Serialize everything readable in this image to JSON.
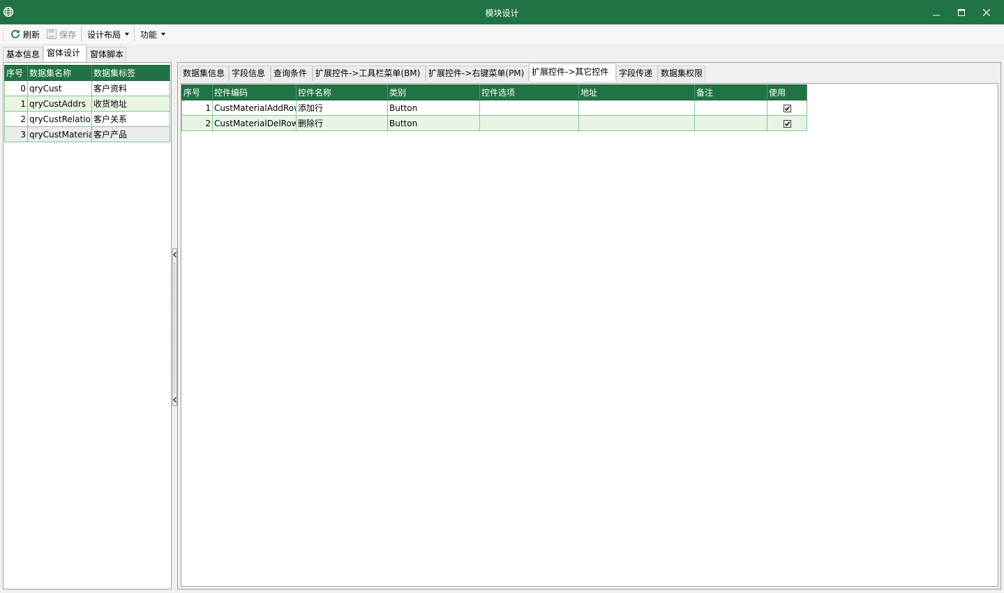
{
  "window": {
    "title": "模块设计",
    "controls": [
      "minimize",
      "maximize",
      "close"
    ]
  },
  "toolbar": {
    "refresh_label": "刷新",
    "save_label": "保存",
    "layout_label": "设计布局",
    "function_label": "功能"
  },
  "top_tabs": [
    "基本信息",
    "窗体设计",
    "窗体脚本"
  ],
  "left_grid": {
    "columns": [
      "序号",
      "数据集名称",
      "数据集标签"
    ],
    "rows": [
      {
        "index": "0",
        "name": "qryCust",
        "label": "客户资料"
      },
      {
        "index": "1",
        "name": "qryCustAddrs",
        "label": "收货地址"
      },
      {
        "index": "2",
        "name": "qryCustRelation",
        "label": "客户关系"
      },
      {
        "index": "3",
        "name": "qryCustMaterial",
        "label": "客户产品"
      }
    ]
  },
  "right_tabs": [
    "数据集信息",
    "字段信息",
    "查询条件",
    "扩展控件->工具栏菜单(BM)",
    "扩展控件->右键菜单(PM)",
    "扩展控件->其它控件",
    "字段传递",
    "数据集权限"
  ],
  "right_grid": {
    "columns": [
      "序号",
      "控件编码",
      "控件名称",
      "类别",
      "控件选项",
      "地址",
      "备注",
      "使用"
    ],
    "rows": [
      {
        "index": "1",
        "code": "CustMaterialAddRow",
        "name": "添加行",
        "type": "Button",
        "options": "",
        "address": "",
        "remark": "",
        "used": true
      },
      {
        "index": "2",
        "code": "CustMaterialDelRow",
        "name": "删除行",
        "type": "Button",
        "options": "",
        "address": "",
        "remark": "",
        "used": true
      }
    ]
  },
  "colors": {
    "accent": "#217346",
    "row_alt": "#e8f5e4",
    "grid_border": "#7ec98a"
  }
}
